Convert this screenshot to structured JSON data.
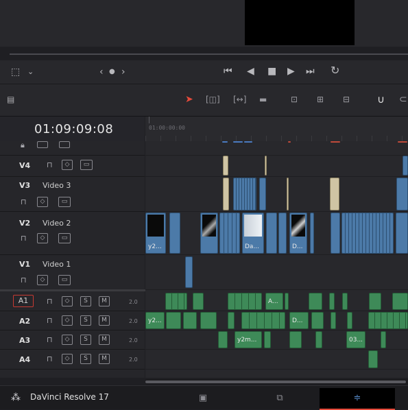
{
  "app": {
    "name": "DaVinci Resolve 17"
  },
  "viewer": {
    "nav_prev": "‹",
    "nav_dot": "●",
    "nav_next": "›"
  },
  "timecode": "01:09:09:08",
  "ruler_timecode": "01:00:00:00",
  "tracks": [
    {
      "id": "V4",
      "label": ""
    },
    {
      "id": "V3",
      "label": "Video 3"
    },
    {
      "id": "V2",
      "label": "Video 2"
    },
    {
      "id": "V1",
      "label": "Video 1"
    },
    {
      "id": "A1",
      "label": "",
      "level": "2.0"
    },
    {
      "id": "A2",
      "label": "",
      "level": "2.0"
    },
    {
      "id": "A3",
      "label": "",
      "level": "2.0"
    },
    {
      "id": "A4",
      "label": "",
      "level": "2.0"
    }
  ],
  "buttons": {
    "solo": "S",
    "mute": "M"
  },
  "clip_labels": {
    "v2_a": "y2...",
    "v2_b": "Da...",
    "v2_c": "D...",
    "a1_a": "A...",
    "a2_a": "y2...",
    "a2_b": "D...",
    "a3_a": "y2m...",
    "a3_b": "03..."
  },
  "icons": {
    "select": "selection-arrow-icon",
    "trim": "trim-edit-icon",
    "dynamic_trim": "dynamic-trim-icon",
    "blade": "blade-icon",
    "insert": "insert-clip-icon",
    "overwrite": "overwrite-clip-icon",
    "replace": "replace-clip-icon",
    "snapping": "snapping-icon",
    "lock": "lock-icon",
    "auto_select": "auto-select-icon",
    "monitor": "track-monitor-icon"
  },
  "colors": {
    "accent_red": "#e64a3b",
    "video_clip": "#4c7aa8",
    "audio_clip": "#3e8a58",
    "title_clip": "#cfc4a4"
  }
}
